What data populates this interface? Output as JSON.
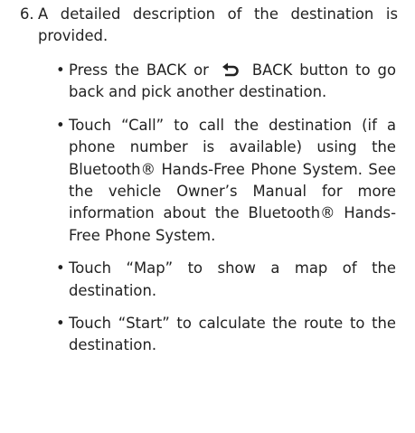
{
  "step": {
    "number": "6.",
    "text": "A detailed description of the destination is provided."
  },
  "bullets": [
    {
      "dot": "•",
      "before_icon": "Press the BACK or",
      "icon": "back-arrow-icon",
      "after_icon": "BACK button to go back and pick another destination."
    },
    {
      "dot": "•",
      "text": "Touch “Call” to call the destination (if a phone number is available) using the Bluetooth® Hands-Free Phone System. See the vehicle Owner’s Manual for more information about the Bluetooth® Hands-Free Phone System."
    },
    {
      "dot": "•",
      "text": "Touch “Map” to show a map of the destination."
    },
    {
      "dot": "•",
      "text": "Touch “Start” to calculate the route to the destination."
    }
  ]
}
